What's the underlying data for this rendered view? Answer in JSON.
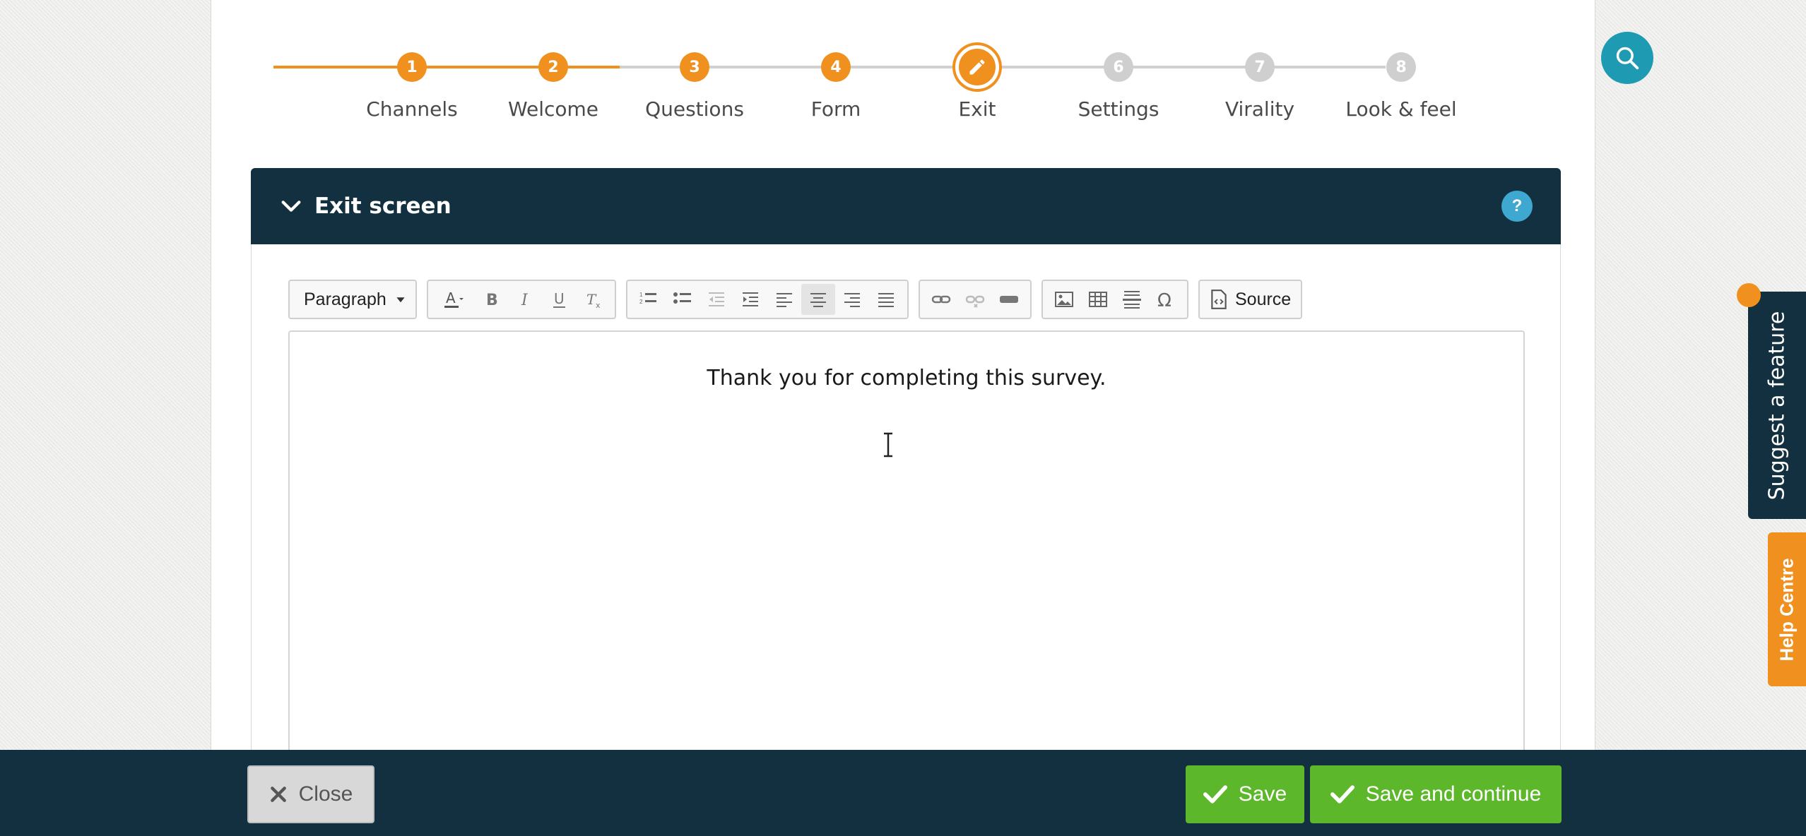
{
  "stepper": {
    "steps": [
      {
        "num": "1",
        "label": "Channels",
        "state": "done"
      },
      {
        "num": "2",
        "label": "Welcome",
        "state": "done"
      },
      {
        "num": "3",
        "label": "Questions",
        "state": "done"
      },
      {
        "num": "4",
        "label": "Form",
        "state": "done"
      },
      {
        "num": "",
        "label": "Exit",
        "state": "current"
      },
      {
        "num": "6",
        "label": "Settings",
        "state": "todo"
      },
      {
        "num": "7",
        "label": "Virality",
        "state": "todo"
      },
      {
        "num": "8",
        "label": "Look & feel",
        "state": "todo"
      }
    ]
  },
  "panel": {
    "title": "Exit screen",
    "help": "?"
  },
  "toolbar": {
    "format_value": "Paragraph",
    "source_label": "Source"
  },
  "editor": {
    "content": "Thank you for completing this survey."
  },
  "side": {
    "suggest_label": "Suggest a feature",
    "help_label": "Help Centre"
  },
  "footer": {
    "close_label": "Close",
    "save_label": "Save",
    "save_continue_label": "Save and continue"
  },
  "colors": {
    "accent": "#f0901e",
    "navy": "#12303f",
    "green": "#5cb82a",
    "teal": "#1f9ab3"
  }
}
